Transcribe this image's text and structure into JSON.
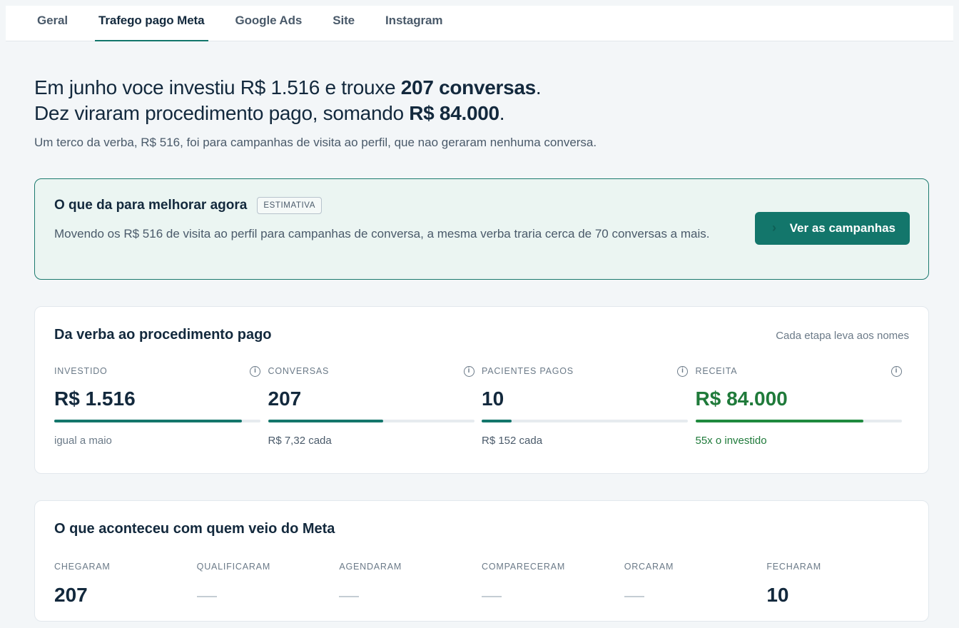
{
  "tabs": [
    {
      "label": "Geral",
      "active": false
    },
    {
      "label": "Trafego pago Meta",
      "active": true
    },
    {
      "label": "Google Ads",
      "active": false
    },
    {
      "label": "Site",
      "active": false
    },
    {
      "label": "Instagram",
      "active": false
    }
  ],
  "summary": {
    "line1_prefix": "Em junho voce investiu R$ 1.516 e trouxe ",
    "line1_bold": "207 conversas",
    "line1_suffix": ".",
    "line2_prefix": "Dez viraram procedimento pago, somando ",
    "line2_bold": "R$ 84.000",
    "line2_suffix": ".",
    "subtext": "Um terco da verba, R$ 516, foi para campanhas de visita ao perfil, que nao geraram nenhuma conversa."
  },
  "improve": {
    "title": "O que da para melhorar agora",
    "badge": "ESTIMATIVA",
    "text": "Movendo os R$ 516 de visita ao perfil para campanhas de conversa, a mesma verba traria cerca de 70 conversas a mais.",
    "cta_label": "Ver as campanhas",
    "cta_icon": "chevron-right-icon"
  },
  "funnel": {
    "title": "Da verba ao procedimento pago",
    "hint": "Cada etapa leva aos nomes",
    "metrics": [
      {
        "label": "INVESTIDO",
        "value": "R$ 1.516",
        "sub": "igual a maio",
        "progress": 0.91,
        "color": "#13766b"
      },
      {
        "label": "CONVERSAS",
        "value": "207",
        "sub": "R$ 7,32 cada",
        "progress": 0.56,
        "color": "#13766b"
      },
      {
        "label": "PACIENTES PAGOS",
        "value": "10",
        "sub": "R$ 152 cada",
        "progress": 0.145,
        "color": "#13766b"
      },
      {
        "label": "RECEITA",
        "value": "R$ 84.000",
        "sub": "55x o investido",
        "progress": 0.815,
        "color": "#1f8a3e"
      }
    ]
  },
  "journey": {
    "title": "O que aconteceu com quem veio do Meta",
    "stages": [
      {
        "label": "CHEGARAM",
        "value": "207"
      },
      {
        "label": "QUALIFICARAM",
        "value": null
      },
      {
        "label": "AGENDARAM",
        "value": null
      },
      {
        "label": "COMPARECERAM",
        "value": null
      },
      {
        "label": "ORCARAM",
        "value": null
      },
      {
        "label": "FECHARAM",
        "value": "10"
      }
    ]
  }
}
